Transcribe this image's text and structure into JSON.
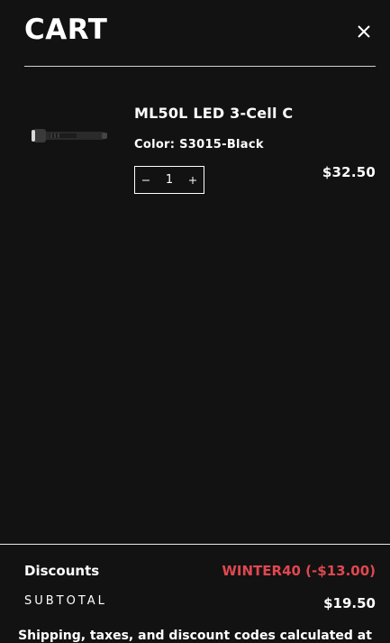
{
  "cart": {
    "title": "CART",
    "close_icon": "close-icon"
  },
  "item": {
    "image_icon": "flashlight-image",
    "name": "ML50L LED 3-Cell C",
    "variant": "Color: S3015-Black",
    "quantity": "1",
    "minus_icon": "minus-icon",
    "plus_icon": "plus-icon",
    "price": "$32.50"
  },
  "summary": {
    "discounts_label": "Discounts",
    "discount_value": "WINTER40 (-$13.00)",
    "subtotal_label": "SUBTOTAL",
    "subtotal_value": "$19.50",
    "note": "Shipping, taxes, and discount codes calculated at"
  },
  "colors": {
    "background": "#121212",
    "text": "#ffffff",
    "discount": "#e0474f"
  }
}
